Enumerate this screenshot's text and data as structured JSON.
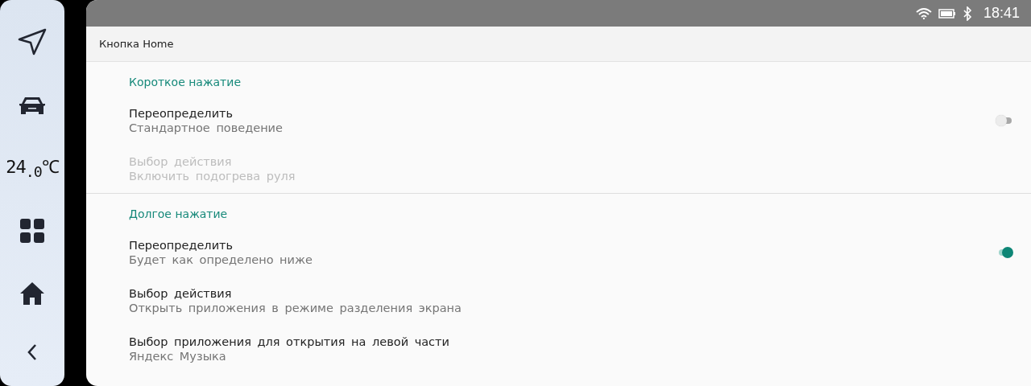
{
  "dock": {
    "items": [
      {
        "kind": "navigate"
      },
      {
        "kind": "car"
      },
      {
        "kind": "temperature",
        "text": "24$_{.0}$℃"
      },
      {
        "kind": "apps"
      },
      {
        "kind": "home"
      },
      {
        "kind": "back"
      }
    ]
  },
  "status_bar": {
    "time": "18:41"
  },
  "header": {
    "title": "Кнопка Home"
  },
  "sections": [
    {
      "title": "Короткое нажатие",
      "items": [
        {
          "kind": "switch",
          "title": "Переопределить",
          "summary": "Стандартное поведение",
          "on": false,
          "disabled": false
        },
        {
          "kind": "choice",
          "title": "Выбор действия",
          "summary": "Включить подогрева руля",
          "disabled": true
        }
      ]
    },
    {
      "title": "Долгое нажатие",
      "items": [
        {
          "kind": "switch",
          "title": "Переопределить",
          "summary": "Будет как определено ниже",
          "on": true,
          "disabled": false
        },
        {
          "kind": "choice",
          "title": "Выбор действия",
          "summary": "Открыть приложения в режиме разделения экрана",
          "disabled": false
        },
        {
          "kind": "choice",
          "title": "Выбор приложения для открытия на левой части",
          "summary": "Яндекс Музыка",
          "disabled": false
        }
      ]
    }
  ]
}
